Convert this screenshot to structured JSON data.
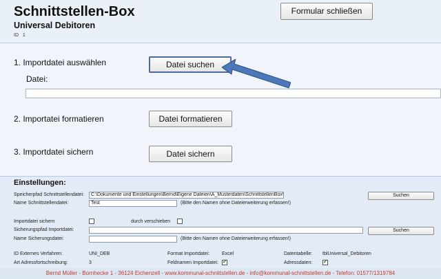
{
  "header": {
    "title": "Schnittstellen-Box",
    "subtitle": "Universal Debitoren",
    "id_label": "ID",
    "id_value": "1",
    "close_button": "Formular schließen"
  },
  "steps": {
    "step1_label": "1. Importdatei auswählen",
    "search_button": "Datei suchen",
    "file_label": "Datei:",
    "file_value": "",
    "step2_label": "2. Importatei formatieren",
    "format_button": "Datei formatieren",
    "step3_label": "3. Importdatei sichern",
    "save_button": "Datei sichern"
  },
  "settings": {
    "title": "Einstellungen:",
    "path_label": "Speicherpfad Schnittstellendatei:",
    "path_value": "C:\\Dokumente und Einstellungen\\Bernd\\Eigene Dateien\\A_Musterdaten\\SchnittstellenBox\\",
    "path_search_button": "Suchen",
    "name_label": "Name Schnittstellendatei:",
    "name_value": "Test",
    "name_hint": "(Bitte den Namen ohne Dateierweiterung erfassen!)",
    "backup_label": "Importdatei sichern",
    "backup_checked": false,
    "move_label": "durch verschieben",
    "move_checked": false,
    "backup_path_label": "Sicherungspfad Importdatei:",
    "backup_path_value": "",
    "backup_search_button": "Suchen",
    "backup_name_label": "Name Sicherungsdatei:",
    "backup_name_value": "",
    "backup_name_hint": "(Bitte den Namen ohne Dateierweiterung erfassen!)",
    "ext_id_label": "ID Externes Verfahren:",
    "ext_id_value": "UNI_DEB",
    "format_label": "Format Importdatei:",
    "format_value": "Excel",
    "table_label": "Datentabelle:",
    "table_value": "tblUniversal_Debitoren",
    "addr_type_label": "Art Adressfortschreibung:",
    "addr_type_value": "3",
    "fieldnames_label": "Feldnamen Importdatei:",
    "fieldnames_checked": true,
    "addr_data_label": "Adressdaten:",
    "addr_data_checked": true
  },
  "footer": {
    "text": "Bernd Müller - Bornhecke 1 - 36124 Eichenzell  -  www.kommunal-schnittstellen.de  -  info@kommunal-schnittstellen.de  -  Telefon: 01577/1319784"
  },
  "colors": {
    "accent_arrow": "#4a78b8",
    "footer_text": "#c0392b"
  }
}
